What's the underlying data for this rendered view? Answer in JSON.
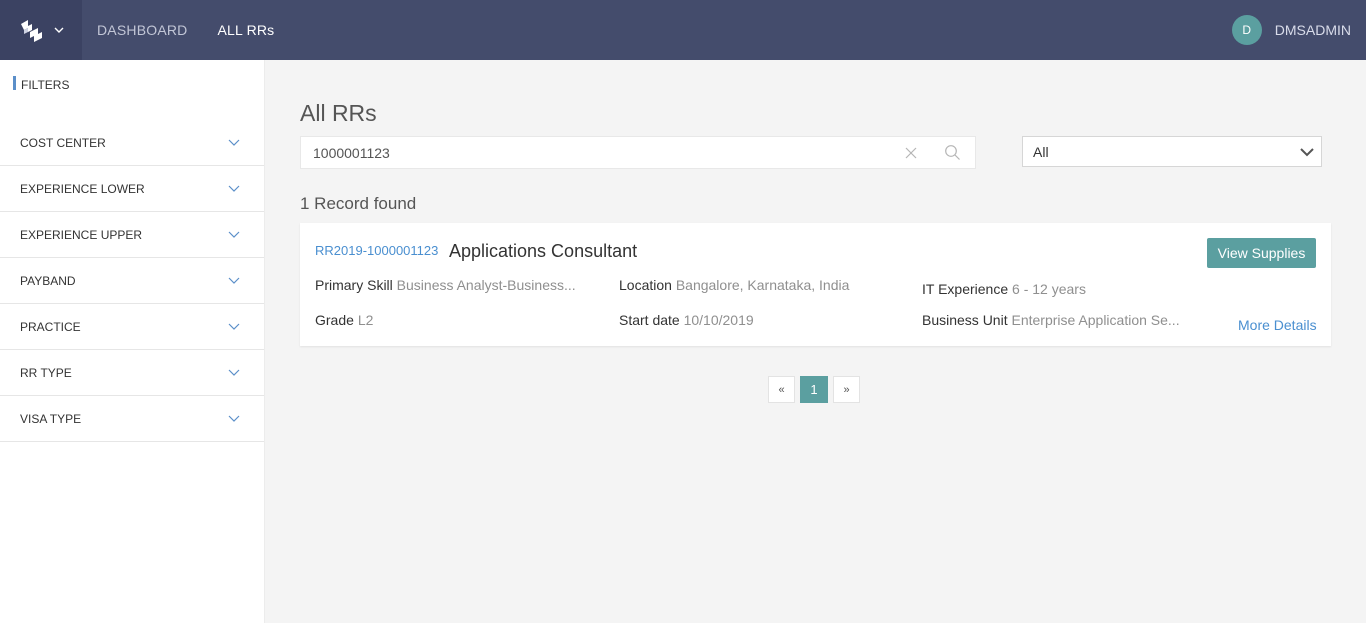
{
  "nav": {
    "dashboard": "DASHBOARD",
    "all_rrs": "ALL RRs"
  },
  "user": {
    "initial": "D",
    "name": "DMSADMIN"
  },
  "sidebar": {
    "title": "FILTERS",
    "filters": [
      {
        "label": "COST CENTER"
      },
      {
        "label": "EXPERIENCE LOWER"
      },
      {
        "label": "EXPERIENCE UPPER"
      },
      {
        "label": "PAYBAND"
      },
      {
        "label": "PRACTICE"
      },
      {
        "label": "RR TYPE"
      },
      {
        "label": "VISA TYPE"
      }
    ]
  },
  "main": {
    "title": "All RRs",
    "search_value": "1000001123",
    "select_value": "All",
    "record_count": "1 Record found"
  },
  "card": {
    "rr_id": "RR2019-1000001123",
    "title": "Applications Consultant",
    "view_button": "View Supplies",
    "more_details": "More Details",
    "fields": {
      "primary_skill": {
        "label": "Primary Skill",
        "value": "Business Analyst-Business..."
      },
      "location": {
        "label": "Location",
        "value": "Bangalore, Karnataka, India"
      },
      "it_experience": {
        "label": "IT Experience",
        "value": "6 - 12 years"
      },
      "grade": {
        "label": "Grade",
        "value": "L2"
      },
      "start_date": {
        "label": "Start date",
        "value": "10/10/2019"
      },
      "business_unit": {
        "label": "Business Unit",
        "value": "Enterprise Application Se..."
      }
    }
  },
  "pagination": {
    "prev": "«",
    "current": "1",
    "next": "»"
  },
  "colors": {
    "topbar": "#444c6c",
    "accent": "#5b9fa0",
    "link": "#4a8fd0"
  }
}
